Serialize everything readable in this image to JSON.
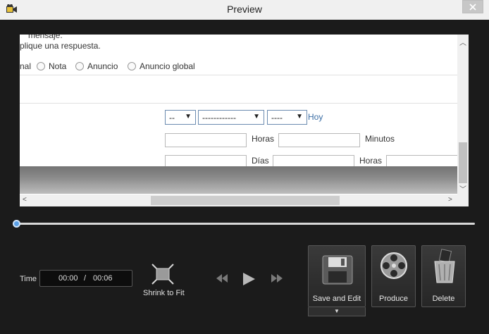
{
  "window": {
    "title": "Preview",
    "icon": "camera-icon"
  },
  "preview": {
    "line1": "mensaje.",
    "line2": "plique una respuesta.",
    "radio_prefix": "nal",
    "radio_options": [
      "Nota",
      "Anuncio",
      "Anuncio global"
    ],
    "selects": [
      "--",
      "------------",
      "----"
    ],
    "today_link": "Hoy",
    "row2_labels": [
      "Horas",
      "Minutos"
    ],
    "row3_labels": [
      "Días",
      "Horas"
    ]
  },
  "timeline": {
    "position": 0.0
  },
  "controls": {
    "time_label": "Time",
    "current_time": "00:00",
    "separator": "/",
    "total_time": "00:06",
    "shrink_label": "Shrink to Fit",
    "save_edit_label": "Save and Edit",
    "produce_label": "Produce",
    "delete_label": "Delete",
    "dropdown_arrow": "▼"
  }
}
